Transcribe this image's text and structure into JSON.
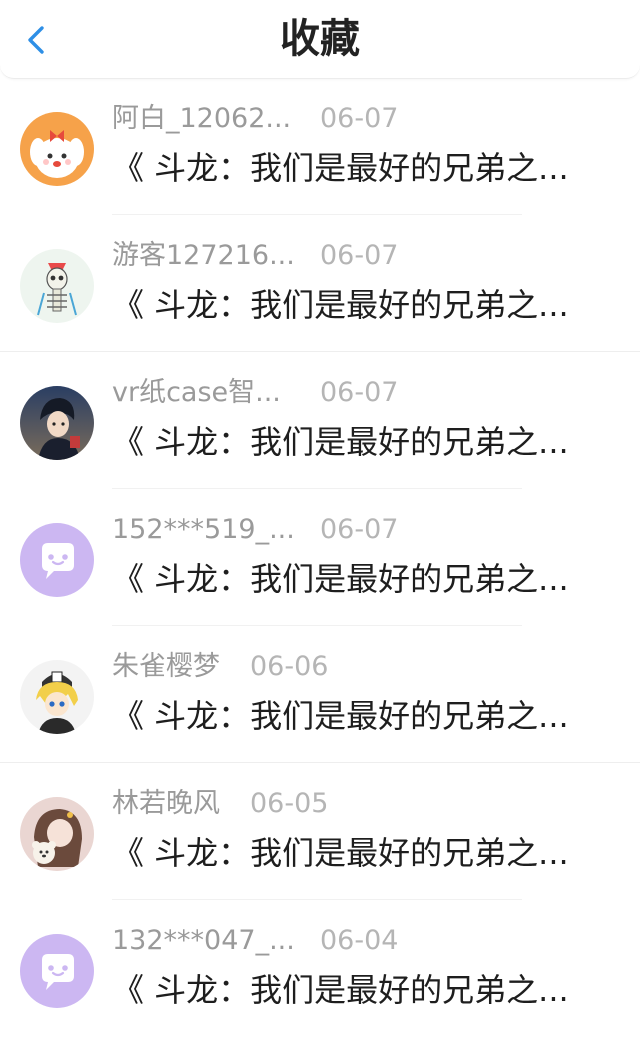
{
  "header": {
    "title": "收藏"
  },
  "items": [
    {
      "user": "阿白_12062...",
      "date": "06-07",
      "text": "《 斗龙：我们是最好的兄弟之...",
      "avatar": "puppy-avatar"
    },
    {
      "user": "游客127216...",
      "date": "06-07",
      "text": "《 斗龙：我们是最好的兄弟之...",
      "avatar": "skeleton-avatar"
    },
    {
      "user": "vr纸case智...",
      "date": "06-07",
      "text": "《 斗龙：我们是最好的兄弟之...",
      "avatar": "anime-boy-avatar"
    },
    {
      "user": "152***519_...",
      "date": "06-07",
      "text": "《 斗龙：我们是最好的兄弟之...",
      "avatar": "default-chat-avatar"
    },
    {
      "user": "朱雀樱梦",
      "date": "06-06",
      "text": "《 斗龙：我们是最好的兄弟之...",
      "avatar": "blonde-anime-avatar"
    },
    {
      "user": "林若晚风",
      "date": "06-05",
      "text": "《 斗龙：我们是最好的兄弟之...",
      "avatar": "girl-bear-avatar"
    },
    {
      "user": "132***047_...",
      "date": "06-04",
      "text": "《 斗龙：我们是最好的兄弟之...",
      "avatar": "default-chat-avatar"
    }
  ]
}
